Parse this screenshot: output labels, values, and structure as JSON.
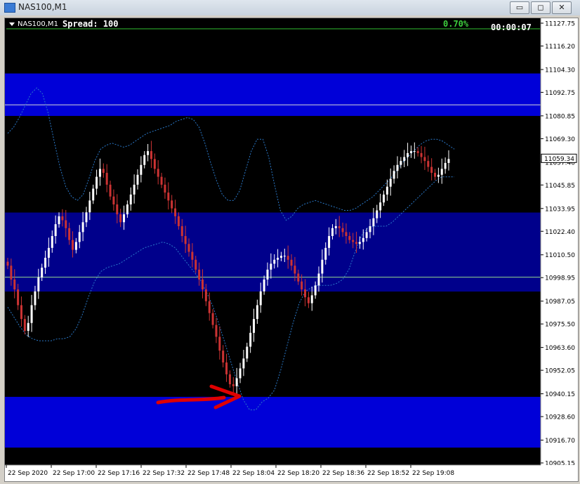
{
  "window": {
    "title": "NAS100,M1",
    "buttons": {
      "minimize": "▭",
      "restore": "◻",
      "close": "✕"
    }
  },
  "header": {
    "symbol": "NAS100,M1",
    "spread_label": "Spread: 100",
    "percent": "0.70%",
    "timer": "00:00:07"
  },
  "colors": {
    "zone": "#0000d8",
    "midzone": "#00008b",
    "up_candle": "#ffffff",
    "down_candle": "#cc3333",
    "band": "#2a78c8",
    "price_axis_bg": "#ffffff",
    "arrow": "#e00000",
    "current_price_line": "#ffffff"
  },
  "price_axis": {
    "labels": [
      "11127.75",
      "11116.20",
      "11104.30",
      "11092.75",
      "11080.85",
      "11069.30",
      "11057.40",
      "11045.85",
      "11033.95",
      "11022.40",
      "11010.50",
      "10998.95",
      "10987.05",
      "10975.50",
      "10963.60",
      "10952.05",
      "10940.15",
      "10928.60",
      "10916.70",
      "10905.15"
    ],
    "current_price": "11059.34"
  },
  "time_axis": {
    "labels": [
      "22 Sep 2020",
      "22 Sep 17:00",
      "22 Sep 17:16",
      "22 Sep 17:32",
      "22 Sep 17:48",
      "22 Sep 18:04",
      "22 Sep 18:20",
      "22 Sep 18:36",
      "22 Sep 18:52",
      "22 Sep 19:08"
    ]
  },
  "zones": [
    {
      "name": "upper-zone",
      "from": 11080.8,
      "to": 11102.3
    },
    {
      "name": "middle-zone",
      "from": 10991.9,
      "to": 11031.9
    },
    {
      "name": "lower-zone",
      "from": 10912.9,
      "to": 10938.6
    }
  ],
  "lines": {
    "upper_zone_line": 11086.4,
    "middle_zone_line": 10999.2
  },
  "chart_data": {
    "type": "candlestick",
    "ylim": [
      10905.15,
      11127.75
    ],
    "close": [
      11005,
      10998,
      10993,
      10985,
      10978,
      10972,
      10976,
      10985,
      10992,
      10999,
      11004,
      11009,
      11014,
      11020,
      11026,
      11030,
      11028,
      11024,
      11018,
      11013,
      11017,
      11022,
      11027,
      11032,
      11038,
      11044,
      11050,
      11054,
      11052,
      11046,
      11040,
      11036,
      11031,
      11027,
      11031,
      11036,
      11041,
      11046,
      11051,
      11056,
      11061,
      11063,
      11059,
      11054,
      11050,
      11046,
      11042,
      11038,
      11034,
      11030,
      11025,
      11020,
      11016,
      11012,
      11008,
      11003,
      10998,
      10993,
      10987,
      10981,
      10975,
      10969,
      10962,
      10956,
      10950,
      10945,
      10944,
      10948,
      10953,
      10958,
      10964,
      10971,
      10978,
      10985,
      10992,
      10998,
      11003,
      11006,
      11008,
      11009,
      11010,
      11010,
      11008,
      11005,
      11001,
      10997,
      10993,
      10989,
      10986,
      10990,
      10995,
      11001,
      11008,
      11014,
      11020,
      11024,
      11025,
      11024,
      11022,
      11020,
      11018,
      11017,
      11016,
      11017,
      11019,
      11022,
      11025,
      11029,
      11033,
      11037,
      11041,
      11045,
      11049,
      11053,
      11056,
      11058,
      11060,
      11062,
      11063,
      11063,
      11062,
      11060,
      11058,
      11055,
      11052,
      11050,
      11051,
      11054,
      11057,
      11059
    ],
    "upper_band": [
      11072,
      11075,
      11080,
      11086,
      11092,
      11095,
      11092,
      11082,
      11068,
      11055,
      11045,
      11040,
      11038,
      11041,
      11049,
      11058,
      11064,
      11066,
      11067,
      11066,
      11065,
      11066,
      11068,
      11070,
      11072,
      11073,
      11074,
      11075,
      11076,
      11078,
      11079,
      11080,
      11079,
      11075,
      11067,
      11057,
      11048,
      11041,
      11038,
      11038,
      11043,
      11053,
      11063,
      11069,
      11069,
      11060,
      11046,
      11033,
      11028,
      11030,
      11034,
      11036,
      11037,
      11038,
      11037,
      11036,
      11035,
      11034,
      11033,
      11033,
      11034,
      11036,
      11038,
      11040,
      11043,
      11046,
      11049,
      11053,
      11057,
      11060,
      11063,
      11066,
      11068,
      11069,
      11069,
      11068,
      11066,
      11064
    ],
    "lower_band": [
      10984,
      10979,
      10974,
      10970,
      10968,
      10967,
      10967,
      10967,
      10968,
      10968,
      10969,
      10973,
      10980,
      10989,
      10997,
      11002,
      11004,
      11005,
      11006,
      11008,
      11010,
      11012,
      11014,
      11015,
      11016,
      11017,
      11016,
      11014,
      11010,
      11006,
      11002,
      10998,
      10992,
      10985,
      10976,
      10966,
      10956,
      10946,
      10937,
      10932,
      10932,
      10936,
      10938,
      10942,
      10952,
      10964,
      10976,
      10986,
      10992,
      10994,
      10995,
      10995,
      10995,
      10996,
      10998,
      11003,
      11012,
      11020,
      11024,
      11025,
      11025,
      11025,
      11027,
      11030,
      11033,
      11036,
      11039,
      11042,
      11045,
      11048,
      11050,
      11050,
      11050
    ]
  }
}
